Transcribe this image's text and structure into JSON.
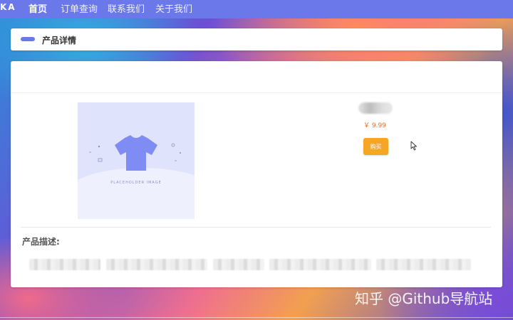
{
  "nav": {
    "brand": "KA",
    "items": [
      {
        "label": "首页",
        "active": true
      },
      {
        "label": "订单查询",
        "active": false
      },
      {
        "label": "联系我们",
        "active": false
      },
      {
        "label": "关于我们",
        "active": false
      }
    ]
  },
  "header": {
    "title": "产品详情"
  },
  "product": {
    "image_placeholder": "PLACEHOLDER IMAGE",
    "price": "￥ 9.99",
    "buy_label": "购买",
    "description_title": "产品描述:"
  },
  "watermark": "知乎 @Github导航站",
  "colors": {
    "accent": "#6a78ea",
    "buy_button": "#f5a623",
    "price": "#e26b2f"
  },
  "icons": {
    "placeholder": "tshirt-icon",
    "cursor": "mouse-pointer-icon"
  }
}
